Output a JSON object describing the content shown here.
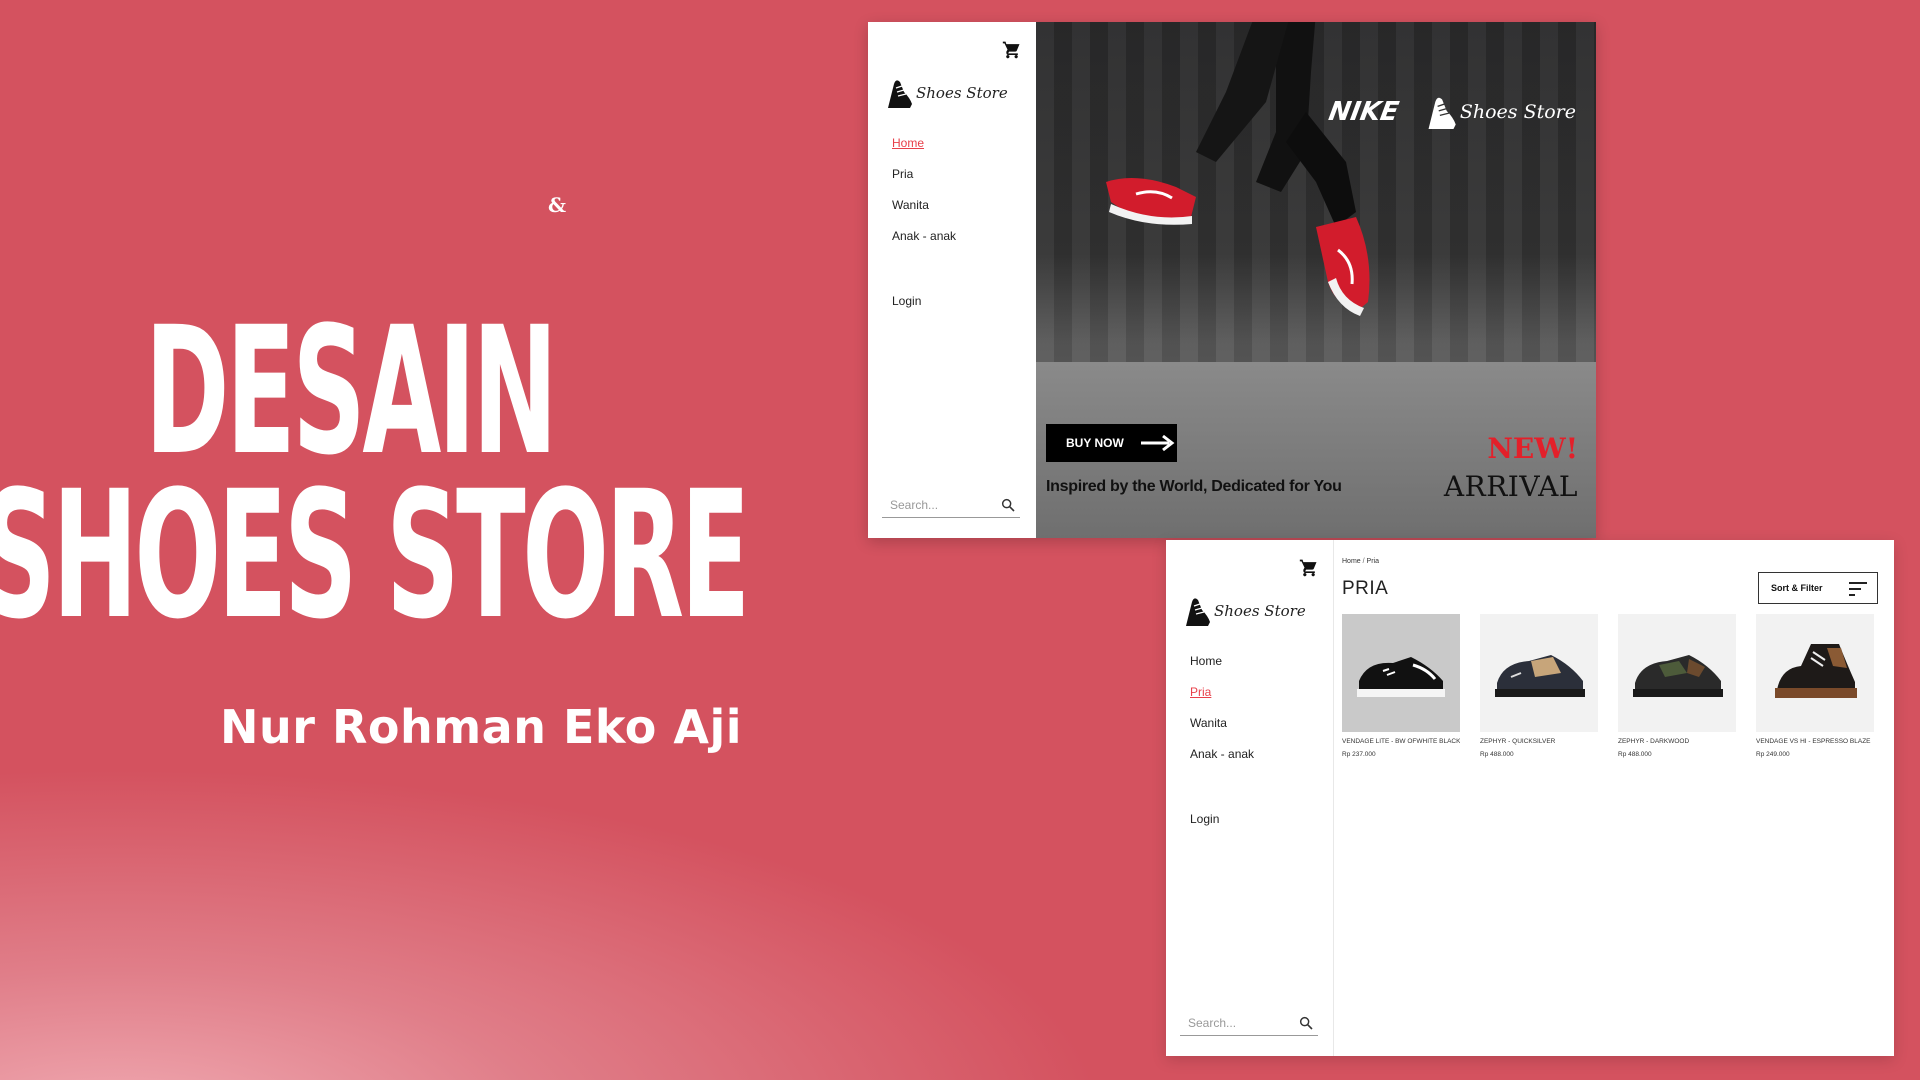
{
  "hero": {
    "amp": "&",
    "title_line1": "DESAIN",
    "title_line2": "SHOES STORE",
    "author": "Nur Rohman Eko Aji"
  },
  "brand": {
    "name": "Shoes Store"
  },
  "nav": {
    "items": [
      "Home",
      "Pria",
      "Wanita",
      "Anak - anak"
    ],
    "login": "Login",
    "search_placeholder": "Search..."
  },
  "home": {
    "active": "Home",
    "banner_logo": "NIKE",
    "buy_now": "BUY NOW",
    "tagline": "Inspired by the World, Dedicated for You",
    "new": "NEW!",
    "arrival": "ARRIVAL"
  },
  "pria": {
    "active": "Pria",
    "breadcrumb_home": "Home",
    "breadcrumb_sep": "/",
    "breadcrumb_current": "Pria",
    "heading": "PRIA",
    "sort_filter": "Sort & Filter",
    "products": [
      {
        "name": "VENDAGE LITE - BW OFWHITE BLACK",
        "price": "Rp 237.000"
      },
      {
        "name": "ZEPHYR - QUICKSILVER",
        "price": "Rp 488.000"
      },
      {
        "name": "ZEPHYR - DARKWOOD",
        "price": "Rp 488.000"
      },
      {
        "name": "VENDAGE VS HI - ESPRESSO BLAZE",
        "price": "Rp 249.000"
      }
    ]
  },
  "colors": {
    "background": "#d4525f",
    "accent": "#e8404a",
    "new_red": "#e3202a"
  }
}
